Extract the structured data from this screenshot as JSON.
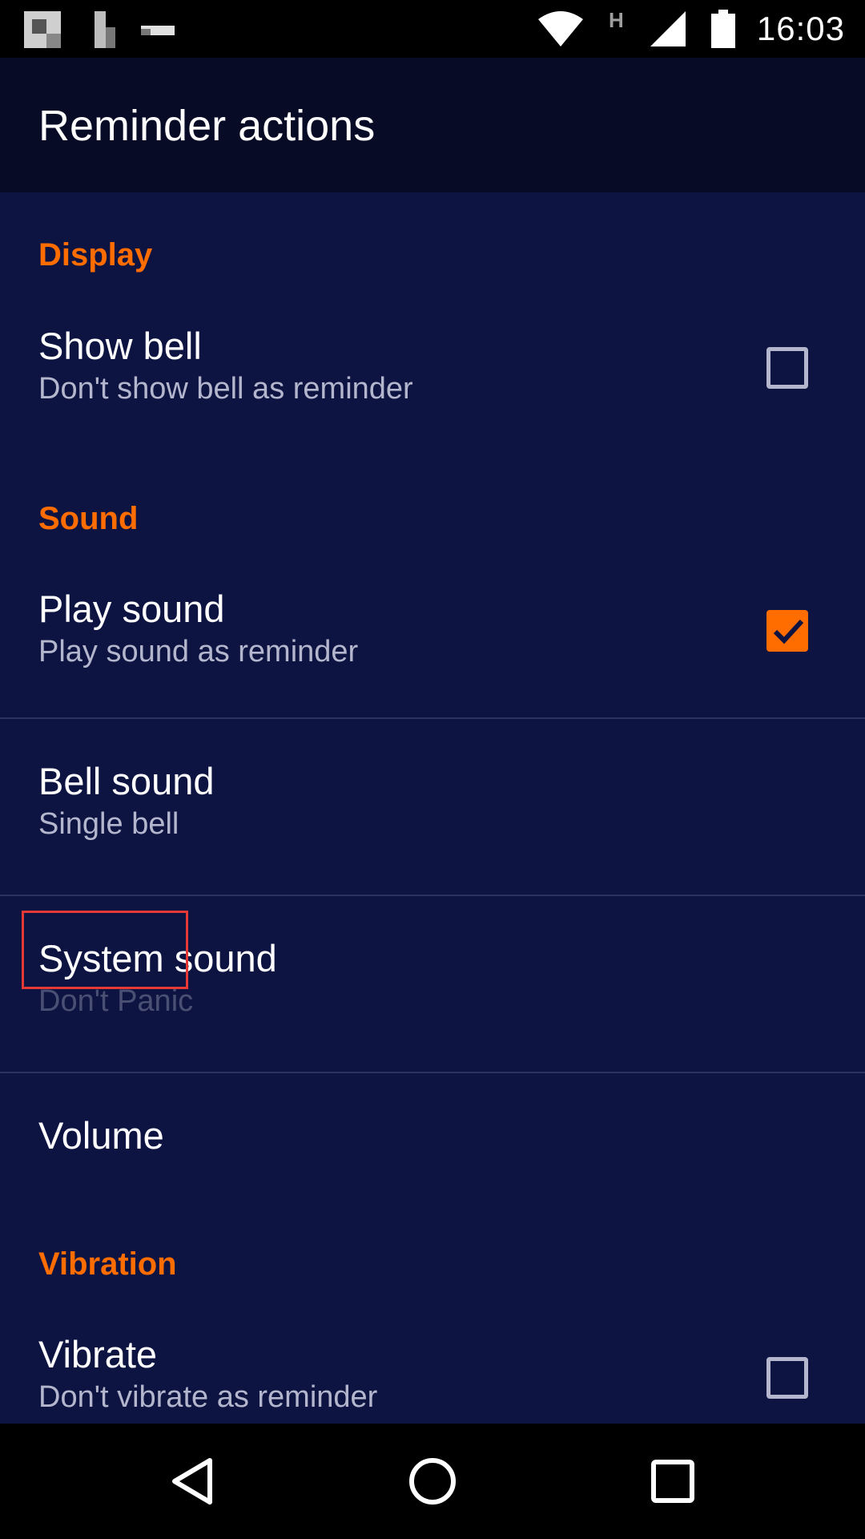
{
  "status_bar": {
    "time": "16:03",
    "network_type": "H",
    "icons": [
      "notification-icon-1",
      "notification-icon-2",
      "notification-icon-3",
      "wifi-icon",
      "cell-signal-icon",
      "battery-icon"
    ]
  },
  "app_bar": {
    "title": "Reminder actions"
  },
  "sections": {
    "display": {
      "header": "Display",
      "show_bell": {
        "title": "Show bell",
        "summary": "Don't show bell as reminder",
        "checked": false
      }
    },
    "sound": {
      "header": "Sound",
      "play_sound": {
        "title": "Play sound",
        "summary": "Play sound as reminder",
        "checked": true
      },
      "bell_sound": {
        "title": "Bell sound",
        "summary": "Single bell"
      },
      "system_sound": {
        "title": "System sound",
        "summary": "Don't Panic",
        "enabled": false
      },
      "volume": {
        "title": "Volume"
      }
    },
    "vibration": {
      "header": "Vibration",
      "vibrate": {
        "title": "Vibrate",
        "summary": "Don't vibrate as reminder",
        "checked": false
      }
    }
  },
  "colors": {
    "accent": "#ff6d00",
    "background": "#0e1442",
    "app_bar": "#070b26",
    "highlight": "#e53935"
  },
  "nav_bar": {
    "icons": [
      "back-icon",
      "home-icon",
      "recents-icon"
    ]
  }
}
